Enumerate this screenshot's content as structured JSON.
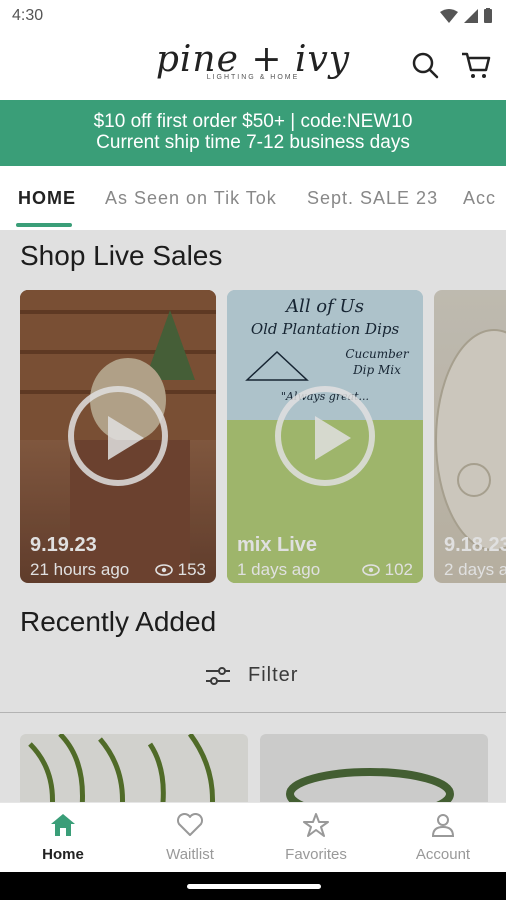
{
  "status": {
    "time": "4:30"
  },
  "brand": {
    "name": "pine + ivy",
    "tagline": "LIGHTING & HOME"
  },
  "promo": {
    "line1": "$10 off first order $50+ | code:NEW10",
    "line2": "Current ship time 7-12 business days",
    "color": "#3a9e78"
  },
  "tabs": [
    {
      "label": "HOME"
    },
    {
      "label": "As Seen on Tik Tok"
    },
    {
      "label": "Sept. SALE 23"
    },
    {
      "label": "Acc"
    }
  ],
  "live": {
    "title": "Shop Live Sales",
    "cards": [
      {
        "date": "9.19.23",
        "ago": "21 hours ago",
        "views": "153"
      },
      {
        "date": "mix Live",
        "ago": "1 days ago",
        "views": "102",
        "poster_text": [
          "All of Us",
          "Old Plantation Dips",
          "Cucumber",
          "Dip Mix",
          "\"Always great..."
        ]
      },
      {
        "date": "9.18.23",
        "ago": "2 days a"
      }
    ]
  },
  "recent": {
    "title": "Recently Added",
    "filter_label": "Filter"
  },
  "nav": [
    {
      "label": "Home",
      "icon": "home-icon"
    },
    {
      "label": "Waitlist",
      "icon": "heart-icon"
    },
    {
      "label": "Favorites",
      "icon": "star-icon"
    },
    {
      "label": "Account",
      "icon": "person-icon"
    }
  ]
}
